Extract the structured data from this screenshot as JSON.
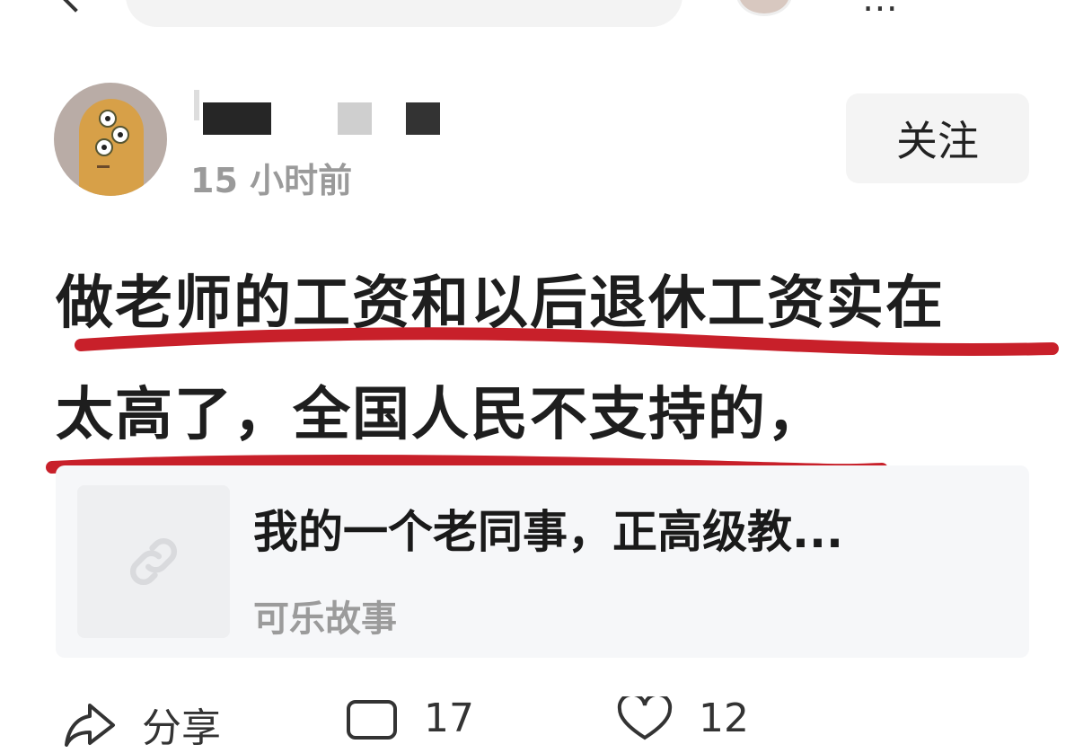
{
  "header": {
    "time_ago": "15 小时前",
    "follow_label": "关注"
  },
  "post": {
    "line1": "做老师的工资和以后退休工资实在",
    "line2": "太高了，全国人民不支持的，",
    "underline_color": "#c8202a"
  },
  "link_card": {
    "title": "我的一个老同事，正高级教...",
    "source": "可乐故事",
    "thumb_icon": "link-icon"
  },
  "actions": {
    "share_label": "分享",
    "comment_count": "17",
    "like_count": "12"
  }
}
